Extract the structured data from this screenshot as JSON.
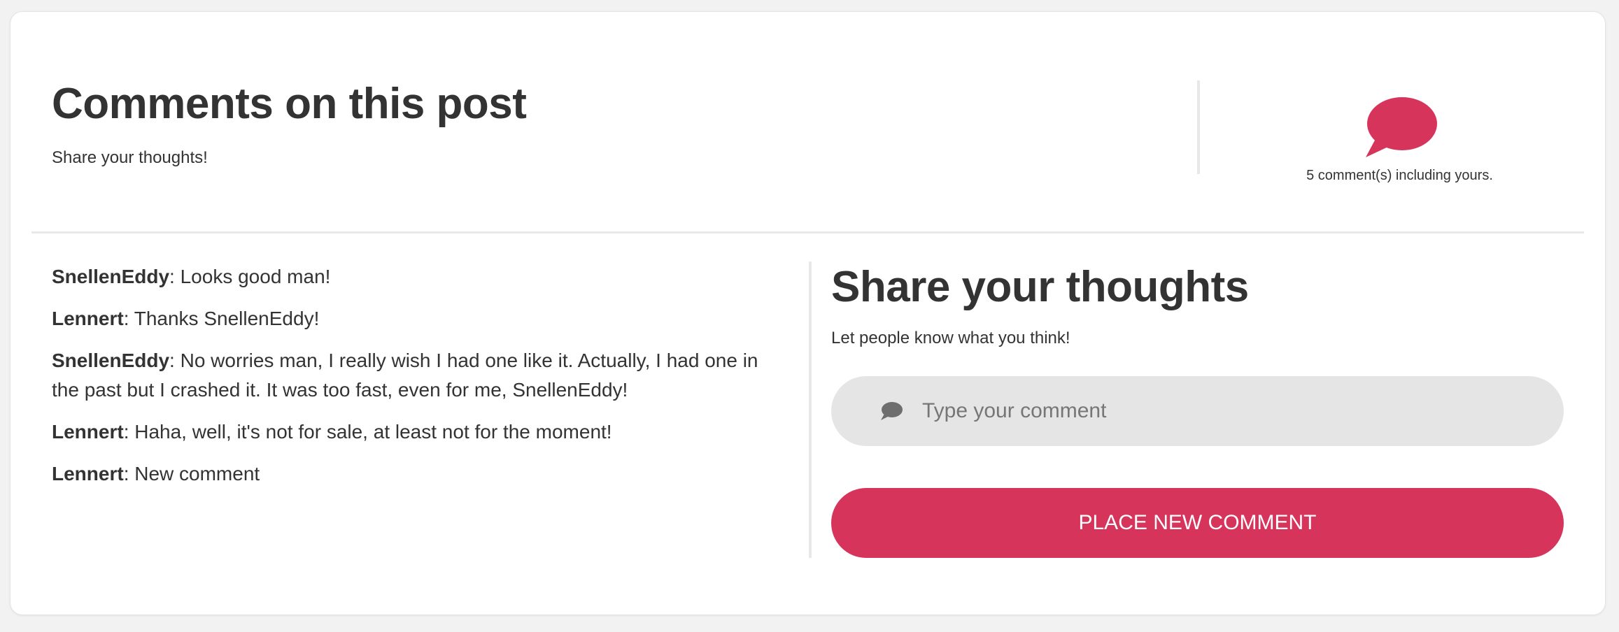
{
  "header": {
    "title": "Comments on this post",
    "subtitle": "Share your thoughts!",
    "count_text": "5 comment(s) including yours.",
    "icon": "speech-bubble-icon"
  },
  "comments": [
    {
      "author": "SnellenEddy",
      "text": ": Looks good man!"
    },
    {
      "author": "Lennert",
      "text": ": Thanks SnellenEddy!"
    },
    {
      "author": "SnellenEddy",
      "text": ": No worries man, I really wish I had one like it. Actually, I had one in the past but I crashed it. It was too fast, even for me, SnellenEddy!"
    },
    {
      "author": "Lennert",
      "text": ": Haha, well, it's not for sale, at least not for the moment!"
    },
    {
      "author": "Lennert",
      "text": ": New comment"
    }
  ],
  "form": {
    "title": "Share your thoughts",
    "subtitle": "Let people know what you think!",
    "input_placeholder": "Type your comment",
    "input_value": "",
    "input_icon": "chat-icon",
    "submit_label": "PLACE NEW COMMENT"
  },
  "colors": {
    "accent": "#d7345c",
    "text": "#333333",
    "input_bg": "#e5e5e5",
    "page_bg": "#f2f2f2"
  }
}
